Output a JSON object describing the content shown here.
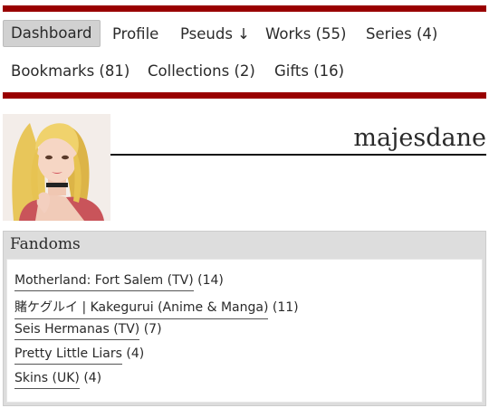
{
  "nav": {
    "items": [
      {
        "label": "Dashboard",
        "current": true
      },
      {
        "label": "Profile"
      },
      {
        "label": "Pseuds ↓"
      },
      {
        "label": "Works (55)"
      },
      {
        "label": "Series (4)"
      },
      {
        "label": "Bookmarks (81)"
      },
      {
        "label": "Collections (2)"
      },
      {
        "label": "Gifts (16)"
      }
    ]
  },
  "header": {
    "username": "majesdane"
  },
  "fandoms": {
    "heading": "Fandoms",
    "items": [
      {
        "name": "Motherland: Fort Salem (TV)",
        "count": "(14)"
      },
      {
        "name": "賭ケグルイ | Kakegurui (Anime & Manga)",
        "count": "(11)"
      },
      {
        "name": "Seis Hermanas (TV)",
        "count": "(7)"
      },
      {
        "name": "Pretty Little Liars",
        "count": "(4)"
      },
      {
        "name": "Skins (UK)",
        "count": "(4)"
      }
    ]
  },
  "colors": {
    "accent": "#990000",
    "current_tab_bg": "#d1d1d1",
    "box_bg": "#dddddd"
  }
}
